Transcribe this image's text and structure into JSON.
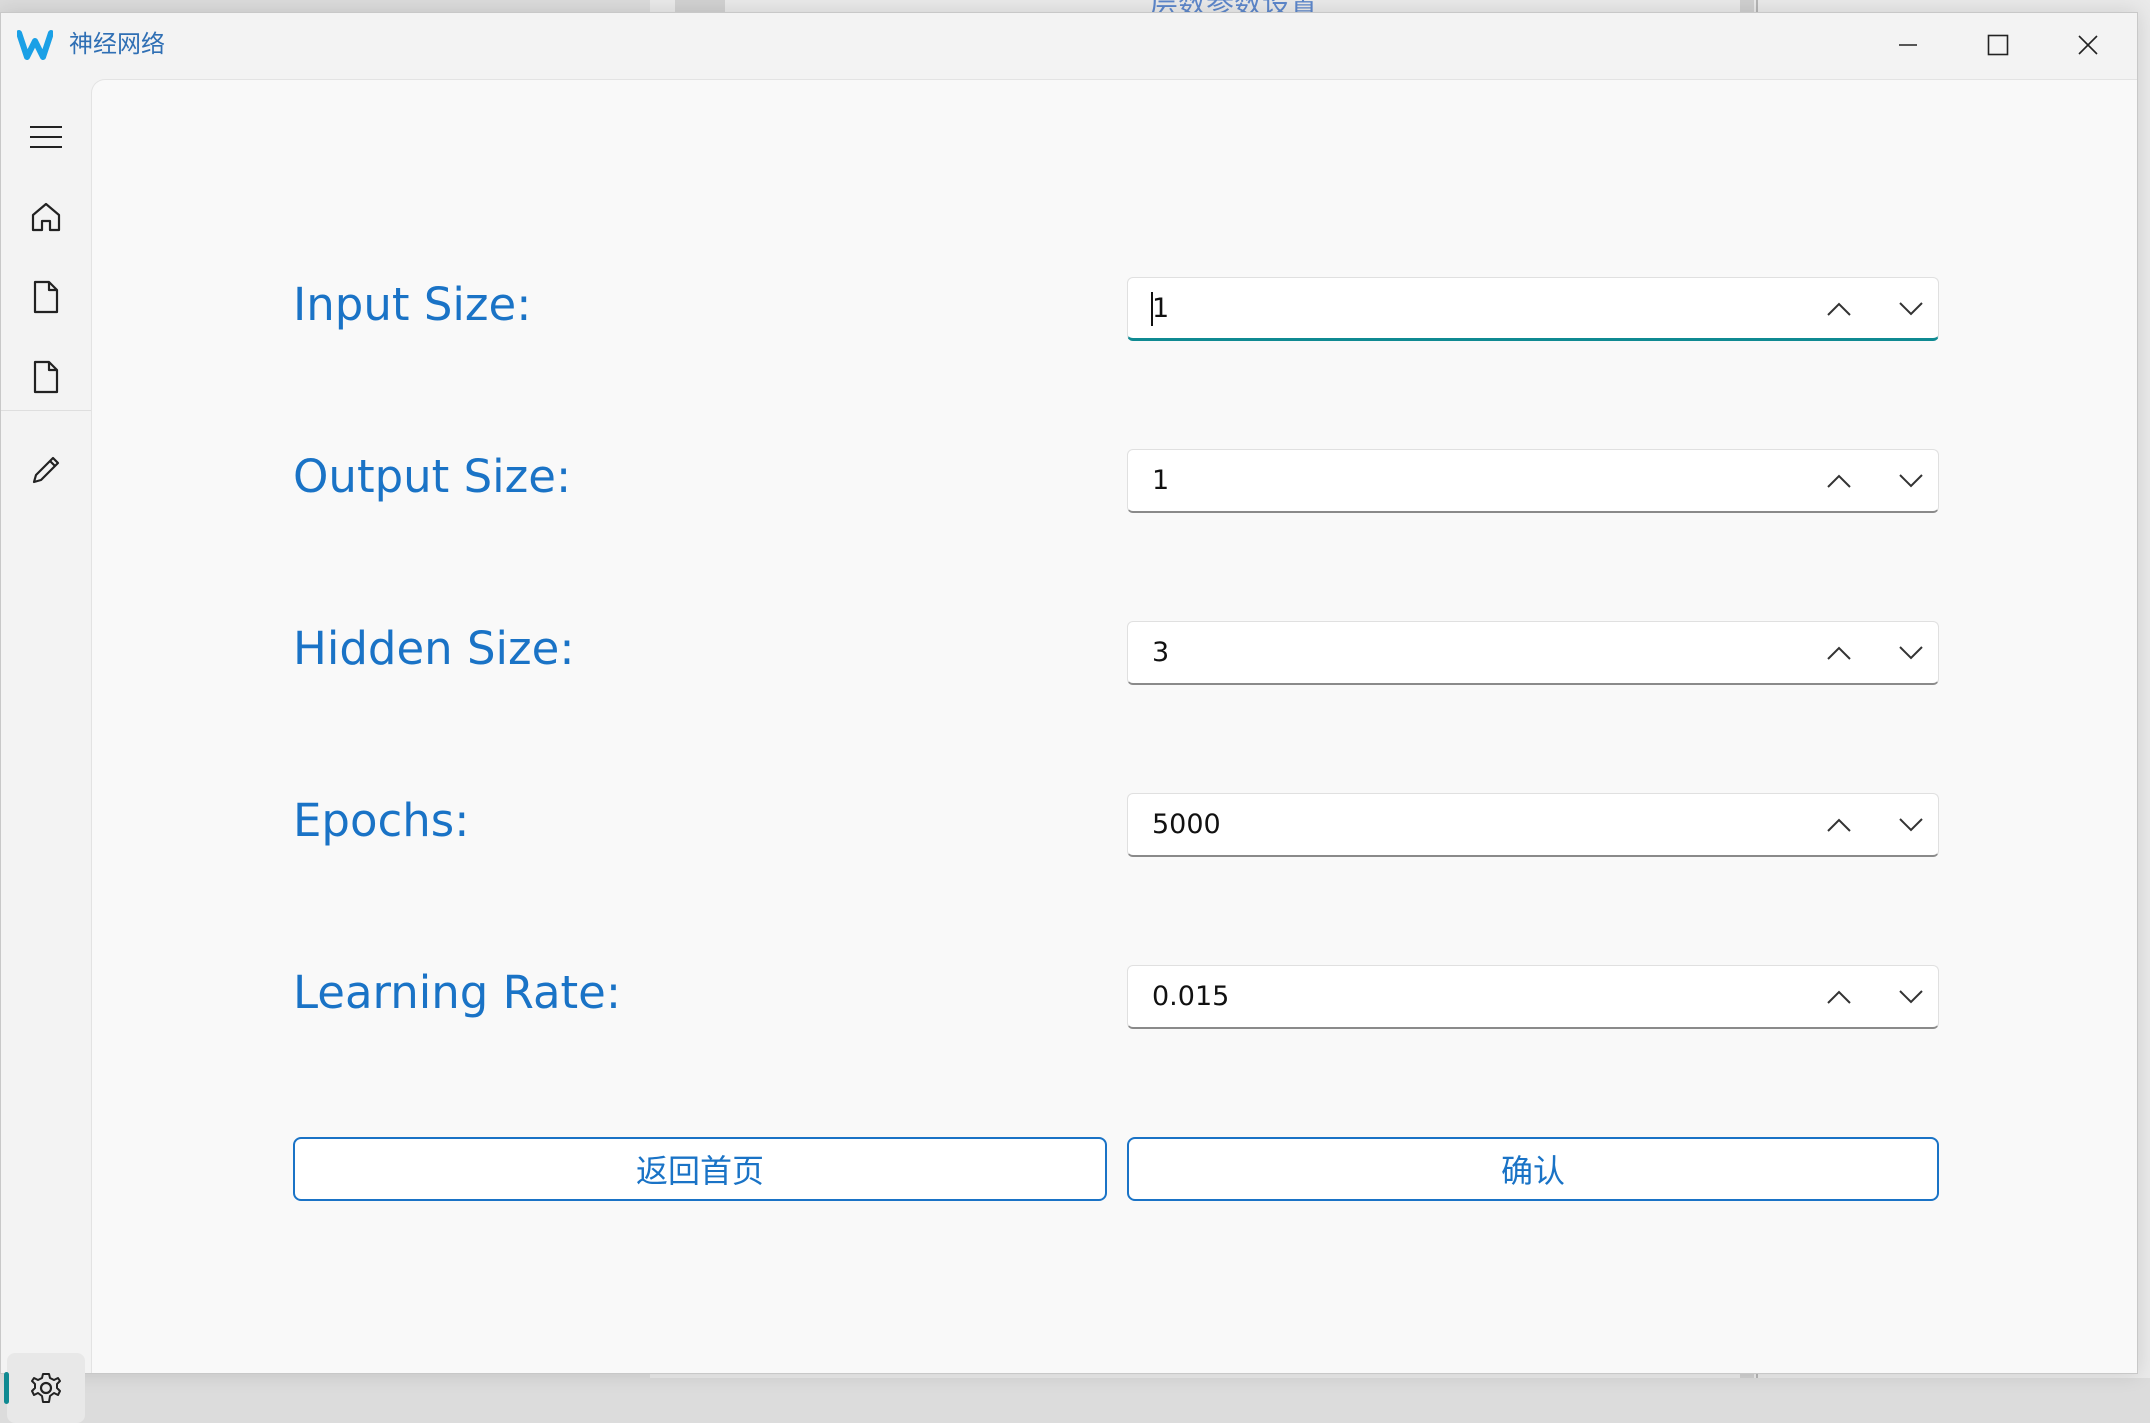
{
  "background": {
    "partial_title": "层数参数设置"
  },
  "window": {
    "title": "神经网络",
    "logo_icon": "w-logo-icon",
    "controls": [
      "minimize-icon",
      "maximize-icon",
      "close-icon"
    ]
  },
  "sidebar": {
    "items": [
      {
        "name": "menu",
        "icon": "hamburger-menu-icon"
      },
      {
        "name": "home",
        "icon": "home-icon"
      },
      {
        "name": "document-1",
        "icon": "document-icon"
      },
      {
        "name": "document-2",
        "icon": "document-icon"
      },
      {
        "name": "edit",
        "icon": "pencil-icon"
      },
      {
        "name": "settings",
        "icon": "gear-icon",
        "active": true
      }
    ]
  },
  "form": {
    "fields": [
      {
        "label": "Input Size:",
        "value": "1",
        "focused": true
      },
      {
        "label": "Output Size:",
        "value": "1"
      },
      {
        "label": "Hidden Size:",
        "value": "3"
      },
      {
        "label": "Epochs:",
        "value": "5000"
      },
      {
        "label": "Learning Rate:",
        "value": "0.015"
      }
    ],
    "back_button": "返回首页",
    "confirm_button": "确认"
  },
  "colors": {
    "accent": "#1a73c6",
    "focus": "#0f8a92",
    "background": "#f9f9f9"
  }
}
